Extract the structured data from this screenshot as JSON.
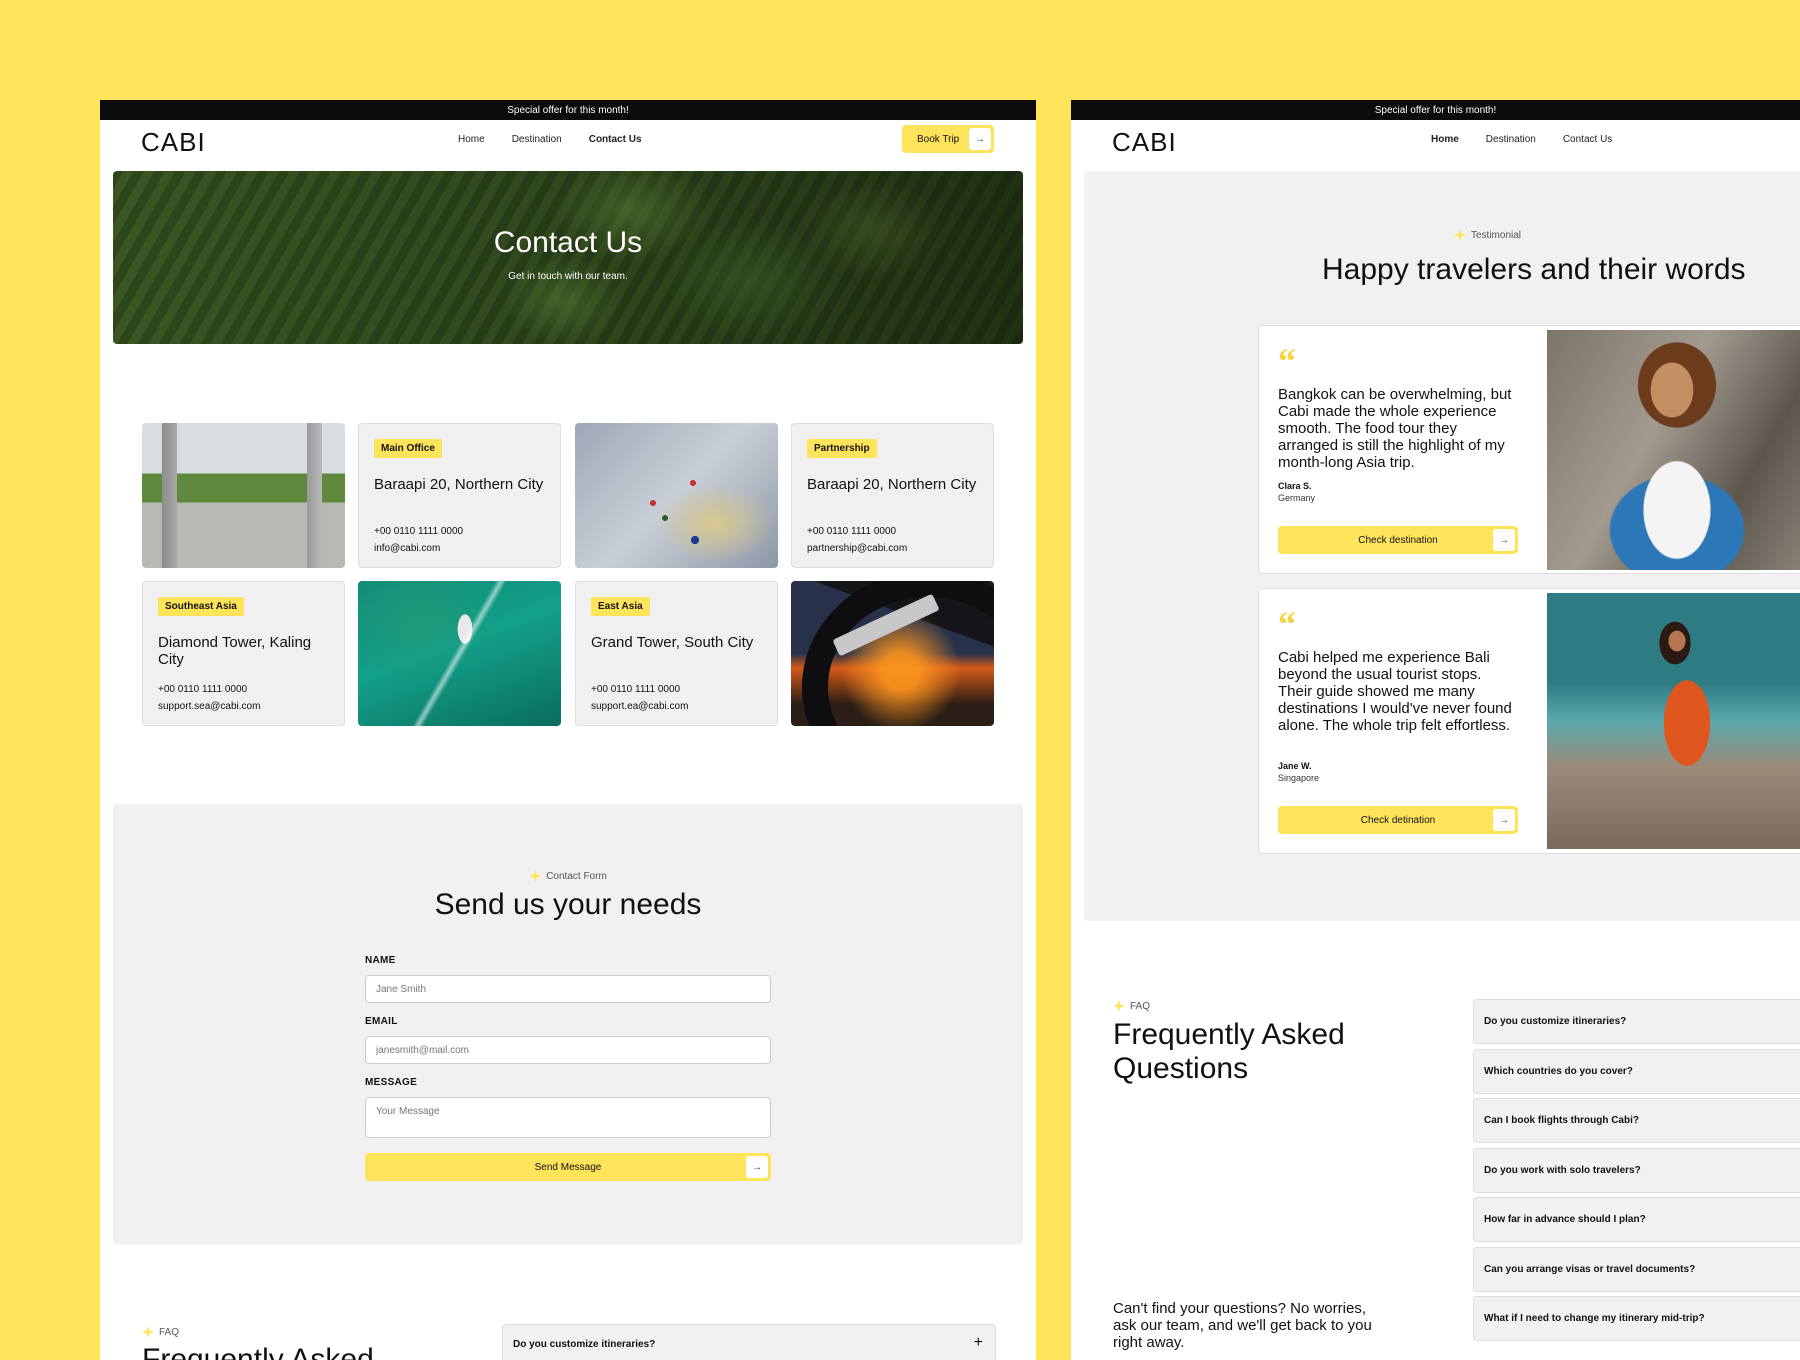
{
  "left_page": {
    "offer_text": "Special offer for this month!",
    "logo": "CABI",
    "nav": [
      "Home",
      "Destination",
      "Contact Us"
    ],
    "book_button": "Book Trip",
    "hero": {
      "title": "Contact Us",
      "subtitle": "Get in touch with our team."
    },
    "offices": [
      {
        "badge": "Main Office",
        "address": "Baraapi 20, Northern City",
        "phone": "+00 0110 1111 0000",
        "email": "info@cabi.com"
      },
      {
        "badge": "Partnership",
        "address": "Baraapi 20, Northern City",
        "phone": "+00 0110 1111 0000",
        "email": "partnership@cabi.com"
      },
      {
        "badge": "Southeast Asia",
        "address": "Diamond Tower, Kaling City",
        "phone": "+00 0110 1111 0000",
        "email": "support.sea@cabi.com"
      },
      {
        "badge": "East Asia",
        "address": "Grand Tower, South City",
        "phone": "+00 0110 1111 0000",
        "email": "support.ea@cabi.com"
      }
    ],
    "contact_form": {
      "eyebrow": "Contact Form",
      "title": "Send us your needs",
      "name_label": "NAME",
      "name_placeholder": "Jane Smith",
      "email_label": "EMAIL",
      "email_placeholder": "janesmith@mail.com",
      "message_label": "MESSAGE",
      "message_placeholder": "Your Message",
      "send_button": "Send Message"
    },
    "faq": {
      "eyebrow": "FAQ",
      "title": "Frequently Asked",
      "first_question": "Do you customize itineraries?"
    }
  },
  "right_page": {
    "offer_text": "Special offer for this month!",
    "logo": "CABI",
    "nav": [
      "Home",
      "Destination",
      "Contact Us"
    ],
    "testimonials": {
      "eyebrow": "Testimonial",
      "title": "Happy travelers and their words",
      "items": [
        {
          "quote": "Bangkok can be overwhelming, but Cabi made the whole experience smooth. The food tour they arranged is still the highlight of my month-long Asia trip.",
          "name": "Clara S.",
          "country": "Germany",
          "button": "Check destination"
        },
        {
          "quote": "Cabi helped me experience Bali beyond the usual tourist stops. Their guide showed me many destinations I would've never found alone. The whole trip felt effortless.",
          "name": "Jane W.",
          "country": "Singapore",
          "button": "Check detination"
        }
      ]
    },
    "faq": {
      "eyebrow": "FAQ",
      "title": "Frequently Asked Questions",
      "note": "Can't find your questions? No worries, ask our team, and we'll get back to you right away.",
      "questions": [
        "Do you customize itineraries?",
        "Which countries do you cover?",
        "Can I book flights through Cabi?",
        "Do you work with solo travelers?",
        "How far in advance should I plan?",
        "Can you arrange visas or travel documents?",
        "What if I need to change my itinerary mid-trip?"
      ]
    }
  },
  "colors": {
    "background": "#FEE45A",
    "accent": "#FEE45A",
    "dark": "#0C0C0C",
    "section_gray": "#F1F1F1"
  },
  "icons": {
    "button_arrow": "arrow-right-icon",
    "eyebrow": "sparkle-icon",
    "faq_toggle": "plus-icon",
    "quote": "quote-mark-icon"
  }
}
